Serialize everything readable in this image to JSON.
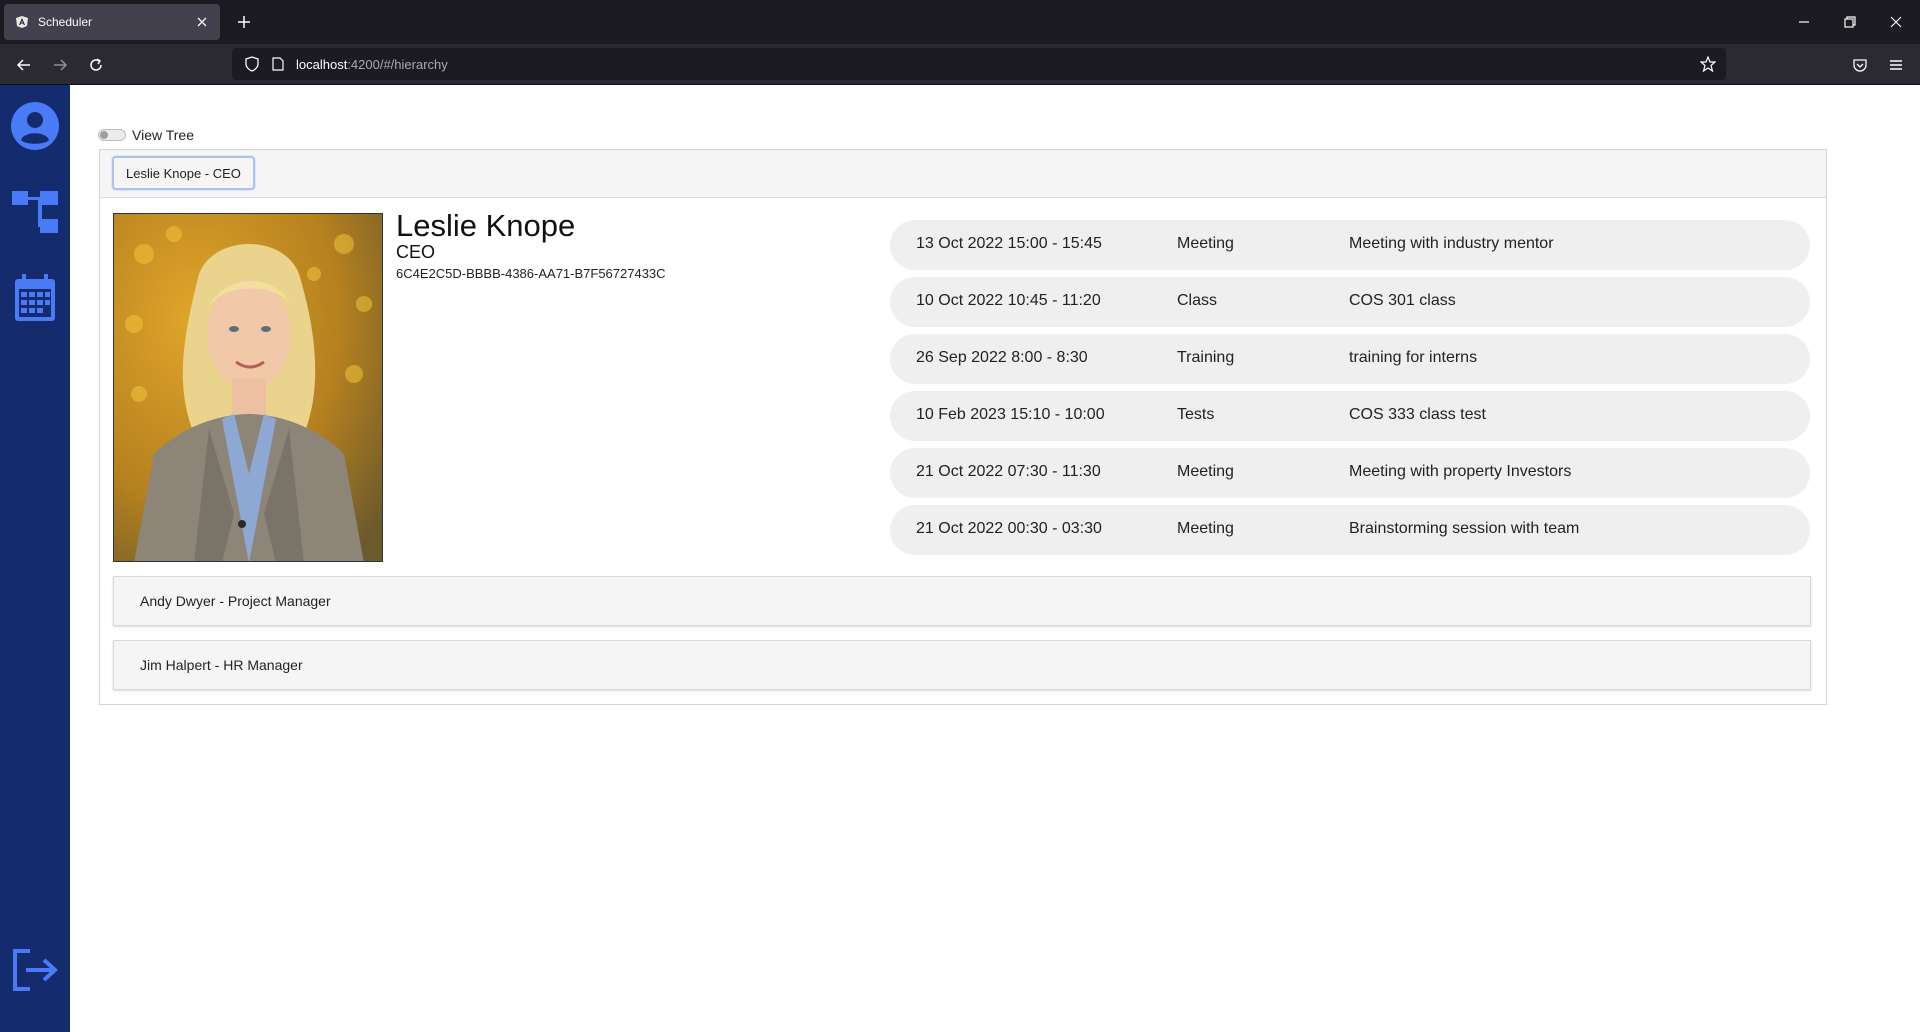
{
  "browser": {
    "tab_title": "Scheduler",
    "url_host": "localhost",
    "url_rest": ":4200/#/hierarchy"
  },
  "sidebar": {
    "icons": [
      "profile-icon",
      "hierarchy-icon",
      "calendar-icon",
      "logout-icon"
    ]
  },
  "view_tree": {
    "label": "View Tree",
    "enabled": false
  },
  "node": {
    "button_label": "Leslie Knope - CEO",
    "name": "Leslie Knope",
    "role": "CEO",
    "id": "6C4E2C5D-BBBB-4386-AA71-B7F56727433C"
  },
  "events": [
    {
      "when": "13 Oct 2022 15:00 - 15:45",
      "type": "Meeting",
      "desc": "Meeting with industry mentor"
    },
    {
      "when": "10 Oct 2022 10:45 - 11:20",
      "type": "Class",
      "desc": "COS 301 class"
    },
    {
      "when": "26 Sep 2022 8:00 - 8:30",
      "type": "Training",
      "desc": "training for interns"
    },
    {
      "when": "10 Feb 2023 15:10 - 10:00",
      "type": "Tests",
      "desc": "COS 333 class test"
    },
    {
      "when": "21 Oct 2022 07:30 - 11:30",
      "type": "Meeting",
      "desc": "Meeting with property Investors"
    },
    {
      "when": "21 Oct 2022 00:30 - 03:30",
      "type": "Meeting",
      "desc": "Brainstorming session with team"
    }
  ],
  "children": [
    {
      "label": "Andy Dwyer - Project Manager"
    },
    {
      "label": "Jim Halpert - HR Manager"
    }
  ],
  "colors": {
    "sidebar": "#142b6e",
    "sidebar_icon": "#4a7bf7",
    "event_bg": "#efefef"
  }
}
